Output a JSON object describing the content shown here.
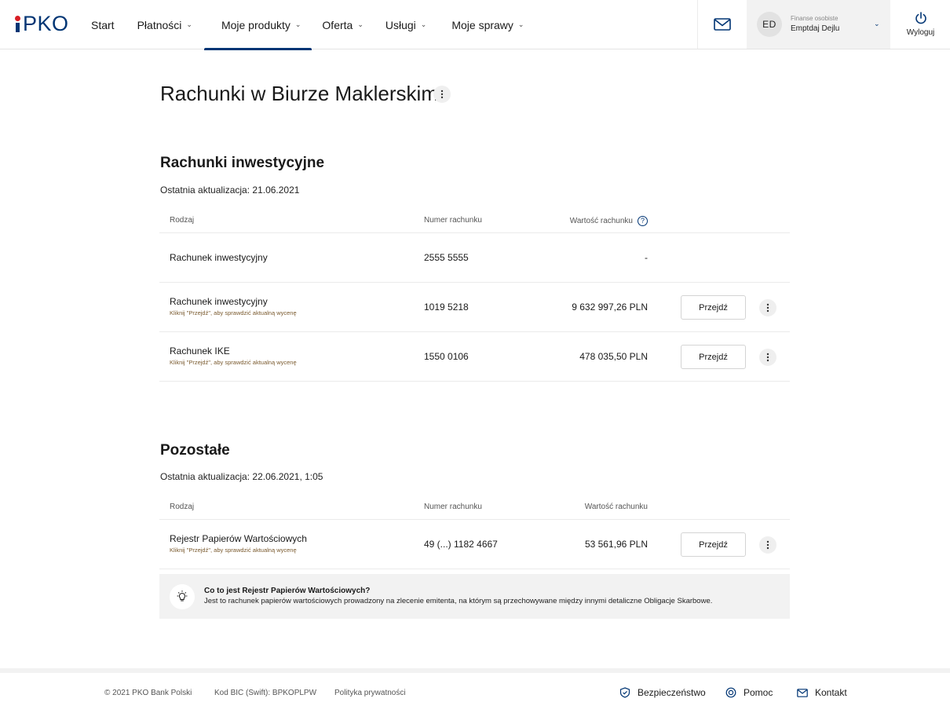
{
  "header": {
    "logo_text": "PKO",
    "nav": [
      {
        "label": "Start",
        "chevron": false,
        "active": false
      },
      {
        "label": "Płatności",
        "chevron": true,
        "active": false
      },
      {
        "label": "Moje produkty",
        "chevron": true,
        "active": true
      },
      {
        "label": "Oferta",
        "chevron": true,
        "active": false
      },
      {
        "label": "Usługi",
        "chevron": true,
        "active": false
      },
      {
        "label": "Moje sprawy",
        "chevron": true,
        "active": false
      }
    ],
    "chevron_glyph": "⌄",
    "mail_icon": "envelope-icon",
    "profile": {
      "initials": "ED",
      "context": "Finanse osobiste",
      "name": "Emptdaj Dejlu"
    },
    "logout_label": "Wyloguj"
  },
  "page": {
    "title": "Rachunki w Biurze Maklerskim",
    "menu_glyph": "⋮"
  },
  "sections": [
    {
      "title": "Rachunki inwestycyjne",
      "updated": "Ostatnia aktualizacja: 21.06.2021",
      "columns": {
        "type": "Rodzaj",
        "number": "Numer rachunku",
        "value": "Wartość rachunku",
        "value_help": "?"
      },
      "rows": [
        {
          "name": "Rachunek inwestycyjny",
          "hint": "",
          "number": "2555 5555",
          "value": "-",
          "action": ""
        },
        {
          "name": "Rachunek inwestycyjny",
          "hint": "Kliknij \"Przejdź\", aby sprawdzić aktualną wycenę",
          "number": "1019 5218",
          "value": "9 632 997,26 PLN",
          "action": "Przejdź"
        },
        {
          "name": "Rachunek IKE",
          "hint": "Kliknij \"Przejdź\", aby sprawdzić aktualną wycenę",
          "number": "1550 0106",
          "value": "478 035,50 PLN",
          "action": "Przejdź"
        }
      ]
    },
    {
      "title": "Pozostałe",
      "updated": "Ostatnia aktualizacja: 22.06.2021, 1:05",
      "columns": {
        "type": "Rodzaj",
        "number": "Numer rachunku",
        "value": "Wartość rachunku",
        "value_help": ""
      },
      "rows": [
        {
          "name": "Rejestr Papierów Wartościowych",
          "hint": "Kliknij \"Przejdź\", aby sprawdzić aktualną wycenę",
          "number": "49 (...) 1182 4667",
          "value": "53 561,96 PLN",
          "action": "Przejdź"
        }
      ]
    }
  ],
  "info": {
    "icon": "lightbulb-icon",
    "title": "Co to jest Rejestr Papierów Wartościowych?",
    "text": "Jest to rachunek papierów wartościowych prowadzony na zlecenie emitenta, na którym są przechowywane między innymi detaliczne Obligacje Skarbowe."
  },
  "footer": {
    "copyright": "© 2021 PKO Bank Polski",
    "bic": "Kod BIC (Swift): BPKOPLPW",
    "privacy": "Polityka prywatności",
    "security": "Bezpieczeństwo",
    "help": "Pomoc",
    "contact": "Kontakt"
  },
  "colors": {
    "brand_navy": "#003574",
    "brand_red": "#d81e25",
    "panel_grey": "#f2f2f2"
  }
}
